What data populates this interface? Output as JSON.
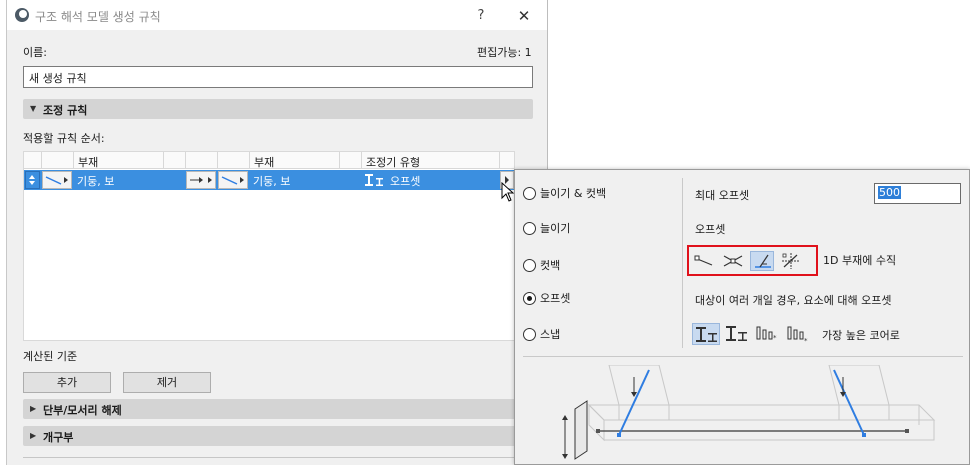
{
  "window": {
    "title": "구조 해석 모델 생성 규칙",
    "help": "?",
    "close": "✕"
  },
  "name_label": "이름:",
  "editable": "편집가능: 1",
  "name_value": "새 생성 규칙",
  "sections": {
    "adjust_rules": "조정 규칙",
    "release": "단부/모서리 해제",
    "openings": "개구부"
  },
  "order_label": "적용할 규칙 순서:",
  "table": {
    "headers": [
      "부재",
      "부재",
      "조정기 유형"
    ],
    "row": {
      "member1": "기둥, 보",
      "member2": "기둥, 보",
      "adjuster": "오프셋"
    }
  },
  "calc_label": "계산된 기준",
  "buttons": {
    "add": "추가",
    "remove": "제거"
  },
  "popup": {
    "options": [
      {
        "label": "늘이기 & 컷백",
        "selected": false
      },
      {
        "label": "늘이기",
        "selected": false
      },
      {
        "label": "컷백",
        "selected": false
      },
      {
        "label": "오프셋",
        "selected": true
      },
      {
        "label": "스냅",
        "selected": false
      }
    ],
    "max_offset_label": "최대 오프셋",
    "max_offset_value": "500",
    "offset_label": "오프셋",
    "perpendicular_label": "1D 부재에 수직",
    "multi_target_label": "대상이 여러 개일 경우, 요소에 대해 오프셋",
    "tallest_core_label": "가장 높은 코어로"
  },
  "colors": {
    "selection": "#3b8fe0",
    "highlight_border": "#e0111b",
    "preview_blue": "#2f7de1"
  }
}
